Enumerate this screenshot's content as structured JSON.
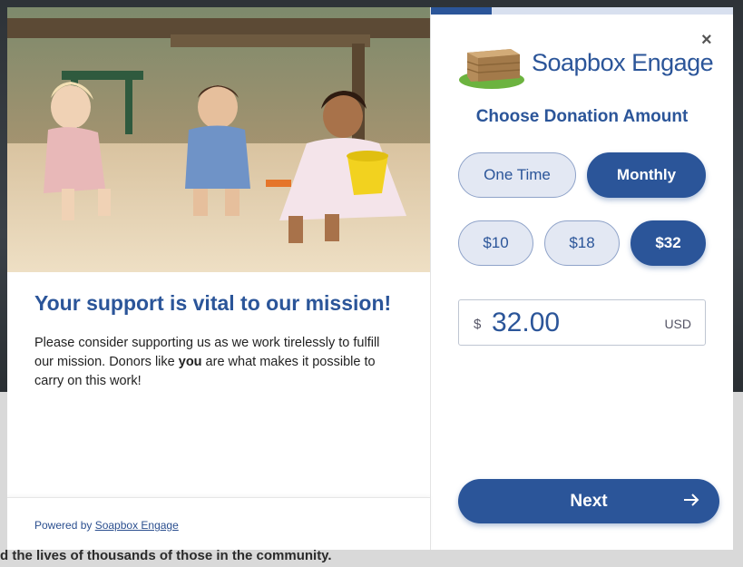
{
  "background": {
    "text_line_1": "d the lives of thousands of those in the community."
  },
  "modal": {
    "left": {
      "headline": "Your support is vital to our mission!",
      "body_before": "Please consider supporting us as we work tirelessly to fulfill our mission. Donors like ",
      "body_bold": "you",
      "body_after": " are what makes it possible to carry on this work!",
      "footer_prefix": "Powered by ",
      "footer_link": "Soapbox Engage"
    },
    "right": {
      "progress_fraction": 0.2,
      "close_label": "×",
      "brand": "Soapbox Engage",
      "title": "Choose Donation Amount",
      "frequency": [
        {
          "label": "One Time",
          "selected": false
        },
        {
          "label": "Monthly",
          "selected": true
        }
      ],
      "amounts": [
        {
          "label": "$10",
          "selected": false
        },
        {
          "label": "$18",
          "selected": false
        },
        {
          "label": "$32",
          "selected": true
        }
      ],
      "currency_symbol": "$",
      "amount_value": "32.00",
      "currency_code": "USD",
      "next_label": "Next"
    }
  },
  "colors": {
    "primary": "#2b5599",
    "pill_bg": "#e3e8f3",
    "progress_track": "#d8e0ef"
  },
  "icons": {
    "close": "close-icon",
    "next": "arrow-right-icon",
    "logo": "soapbox-crate-logo"
  }
}
